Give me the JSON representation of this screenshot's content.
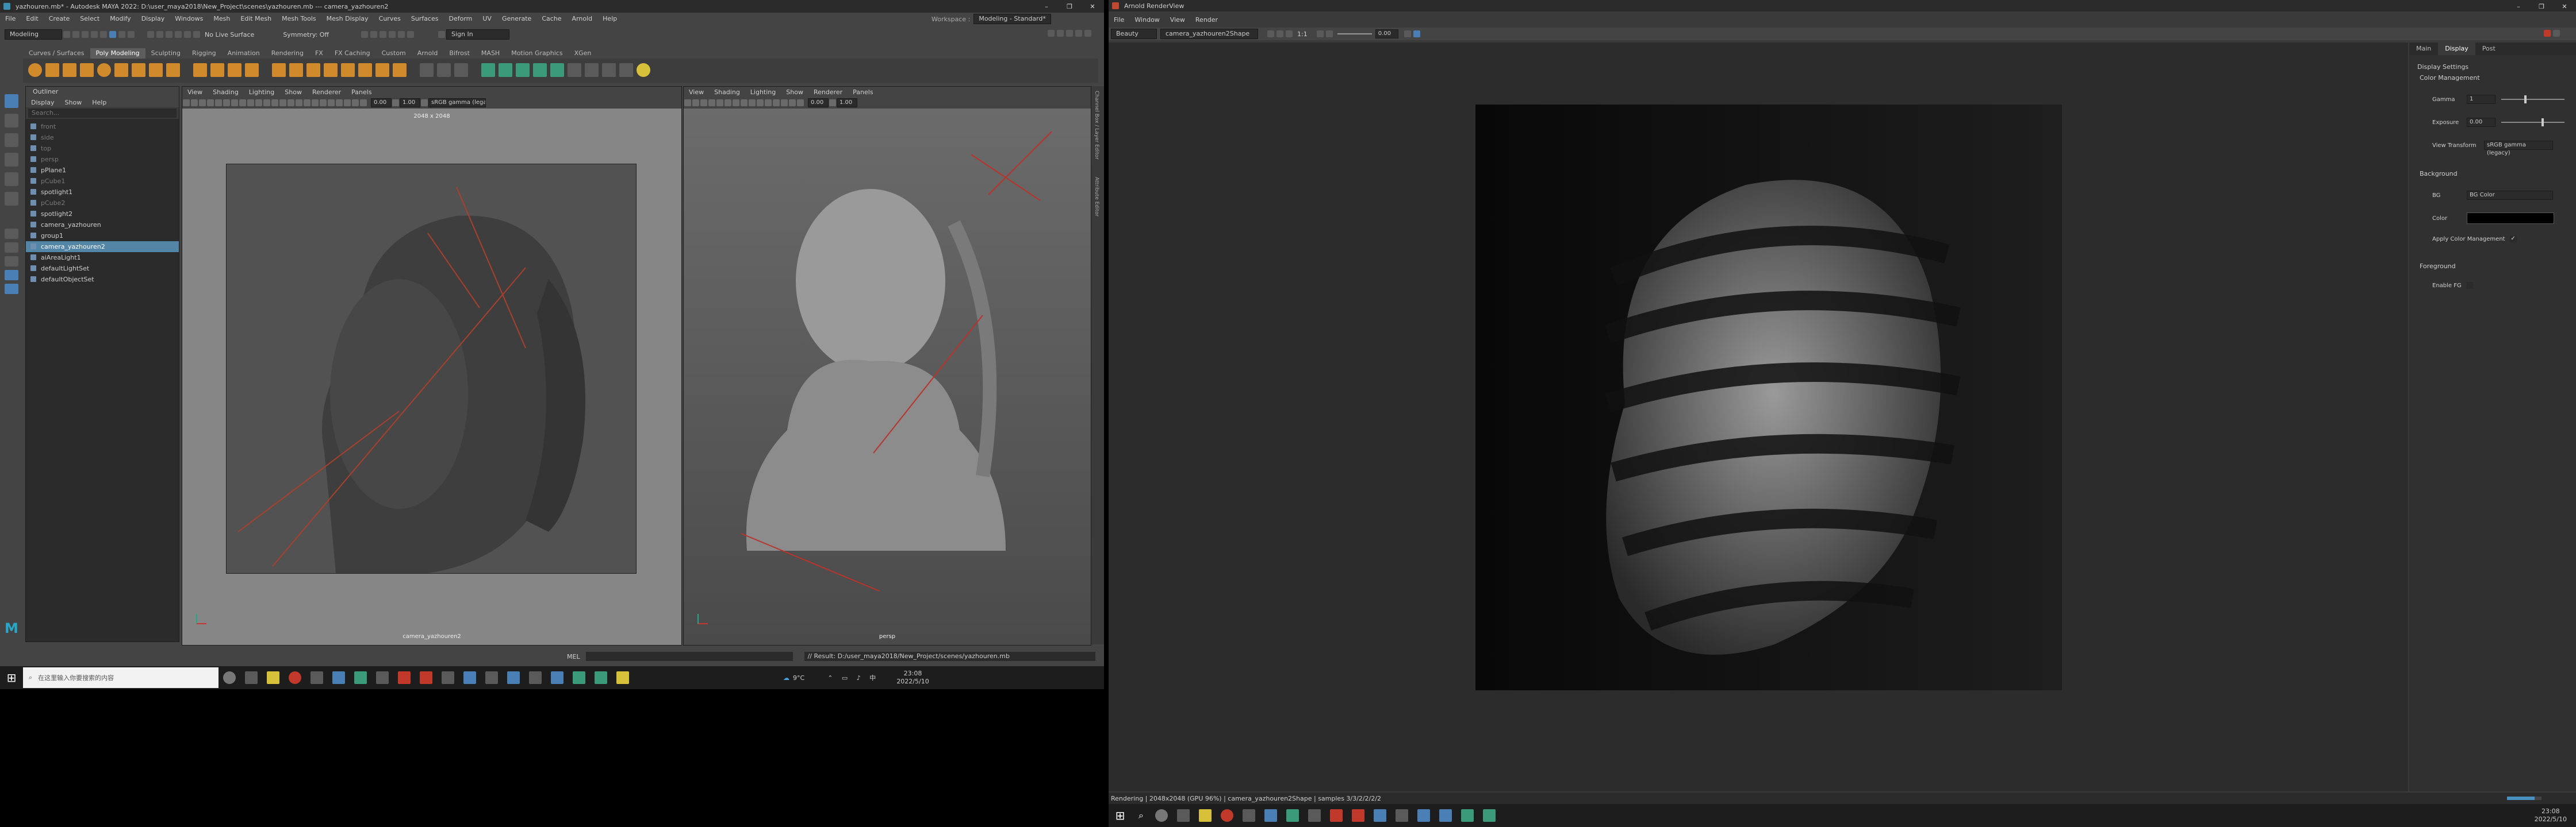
{
  "maya": {
    "title": "yazhouren.mb* - Autodesk MAYA 2022: D:\\user_maya2018\\New_Project\\scenes\\yazhouren.mb  ---  camera_yazhouren2",
    "menubar": [
      "File",
      "Edit",
      "Create",
      "Select",
      "Modify",
      "Display",
      "Windows",
      "Mesh",
      "Edit Mesh",
      "Mesh Tools",
      "Mesh Display",
      "Curves",
      "Surfaces",
      "Deform",
      "UV",
      "Generate",
      "Cache",
      "Arnold",
      "Help"
    ],
    "workspace_label": "Workspace :",
    "workspace_value": "Modeling - Standard*",
    "mode_select": "Modeling",
    "live_surface": "No Live Surface",
    "symmetry": "Symmetry: Off",
    "sign_in": "Sign In",
    "shelf_tabs": [
      "Curves / Surfaces",
      "Poly Modeling",
      "Sculpting",
      "Rigging",
      "Animation",
      "Rendering",
      "FX",
      "FX Caching",
      "Custom",
      "Arnold",
      "Bifrost",
      "MASH",
      "Motion Graphics",
      "XGen"
    ],
    "shelf_active": "Poly Modeling",
    "outliner": {
      "title": "Outliner",
      "menu": [
        "Display",
        "Show",
        "Help"
      ],
      "search_placeholder": "Search...",
      "items": [
        {
          "label": "front",
          "dim": true
        },
        {
          "label": "side",
          "dim": true
        },
        {
          "label": "top",
          "dim": true
        },
        {
          "label": "persp",
          "dim": true
        },
        {
          "label": "pPlane1",
          "dim": false
        },
        {
          "label": "pCube1",
          "dim": true
        },
        {
          "label": "spotlight1",
          "dim": false
        },
        {
          "label": "pCube2",
          "dim": true
        },
        {
          "label": "spotlight2",
          "dim": false
        },
        {
          "label": "camera_yazhouren",
          "dim": false
        },
        {
          "label": "group1",
          "dim": false
        },
        {
          "label": "camera_yazhouren2",
          "dim": false,
          "selected": true
        },
        {
          "label": "aiAreaLight1",
          "dim": false
        },
        {
          "label": "defaultLightSet",
          "dim": false
        },
        {
          "label": "defaultObjectSet",
          "dim": false
        }
      ]
    },
    "viewport_menu": [
      "View",
      "Shading",
      "Lighting",
      "Show",
      "Renderer",
      "Panels"
    ],
    "viewport_left": {
      "resolution": "2048 x 2048",
      "camera": "camera_yazhouren2",
      "field1": "0.00",
      "field2": "1.00",
      "colorspace": "sRGB gamma (legacy)"
    },
    "viewport_right": {
      "camera": "persp",
      "field1": "0.00",
      "field2": "1.00"
    },
    "right_strip": [
      "Channel Box / Layer Editor",
      "Attribute Editor"
    ],
    "mel_label": "MEL",
    "result": "// Result: D:/user_maya2018/New_Project/scenes/yazhouren.mb"
  },
  "arnold": {
    "title": "Arnold RenderView",
    "menubar": [
      "File",
      "Window",
      "View",
      "Render"
    ],
    "aov": "Beauty",
    "camera": "camera_yazhouren2Shape",
    "zoom": "1:1",
    "exposure": "0.00",
    "tabs": [
      "Main",
      "Display",
      "Post"
    ],
    "panel": {
      "header": "Display Settings",
      "color_mgmt": "Color Management",
      "gamma_label": "Gamma",
      "gamma_value": "1",
      "exposure_label": "Exposure",
      "exposure_value": "0.00",
      "view_transform_label": "View Transform",
      "view_transform_value": "sRGB gamma (legacy)",
      "background_header": "Background",
      "bg_label": "BG",
      "bg_value": "BG Color",
      "color_label": "Color",
      "color_swatch": "#000000",
      "apply_cm": "Apply Color Management",
      "foreground_header": "Foreground",
      "enable_fg": "Enable FG"
    },
    "status": "Rendering | 2048x2048 (GPU 96%) | camera_yazhouren2Shape | samples 3/3/2/2/2/2"
  },
  "taskbar_left": {
    "search_placeholder": "在这里输入你要搜索的内容",
    "weather": "9°C",
    "time": "23:08",
    "date": "2022/5/10"
  },
  "taskbar_right": {
    "time": "23:08",
    "date": "2022/5/10"
  },
  "colors": {
    "selection": "#5285a6",
    "maya_bg": "#444444",
    "panel_dark": "#2b2b2b",
    "accent_orange": "#d0892b"
  }
}
